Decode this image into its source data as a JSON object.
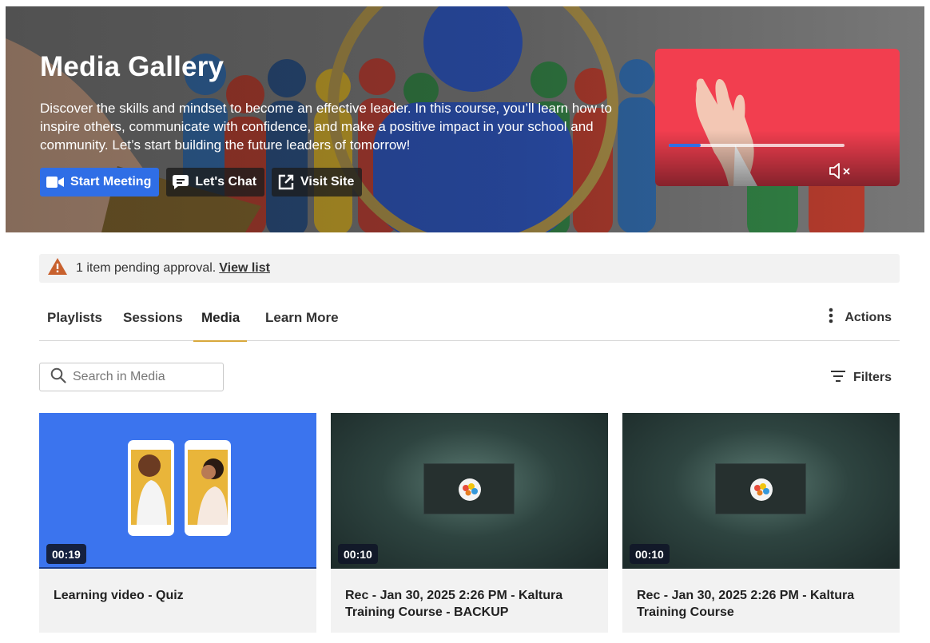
{
  "hero": {
    "title": "Media Gallery",
    "description": "Discover the skills and mindset to become an effective leader. In this course, you’ll learn how to inspire others, communicate with confidence, and make a positive impact in your school and community. Let’s start building the future leaders of tomorrow!",
    "buttons": [
      {
        "label": "Start Meeting",
        "icon": "video-camera-icon",
        "style": "primary"
      },
      {
        "label": "Let's Chat",
        "icon": "chat-icon",
        "style": "dark"
      },
      {
        "label": "Visit Site",
        "icon": "external-link-icon",
        "style": "dark"
      }
    ],
    "video_preview": {
      "progress_fraction": 0.18,
      "mute_icon": "speaker-muted-icon"
    }
  },
  "alert": {
    "icon": "warning-icon",
    "message": "1 item pending approval.",
    "link_label": "View list"
  },
  "tabs": [
    {
      "label": "Playlists",
      "active": false
    },
    {
      "label": "Sessions",
      "active": false
    },
    {
      "label": "Media",
      "active": true
    },
    {
      "label": "Learn More",
      "active": false
    }
  ],
  "actions_label": "Actions",
  "search": {
    "placeholder": "Search in Media",
    "value": ""
  },
  "filters_label": "Filters",
  "media": [
    {
      "title": "Learning video - Quiz",
      "duration": "00:19",
      "thumb": "phones"
    },
    {
      "title": "Rec - Jan 30, 2025 2:26 PM - Kaltura Training Course - BACKUP",
      "duration": "00:10",
      "thumb": "recording"
    },
    {
      "title": "Rec - Jan 30, 2025 2:26 PM - Kaltura Training Course",
      "duration": "00:10",
      "thumb": "recording"
    }
  ],
  "colors": {
    "accent": "#2f6ee6",
    "tab_underline": "#d8a83c",
    "warning": "#c8612e",
    "video_bg": "#f23e4f"
  }
}
